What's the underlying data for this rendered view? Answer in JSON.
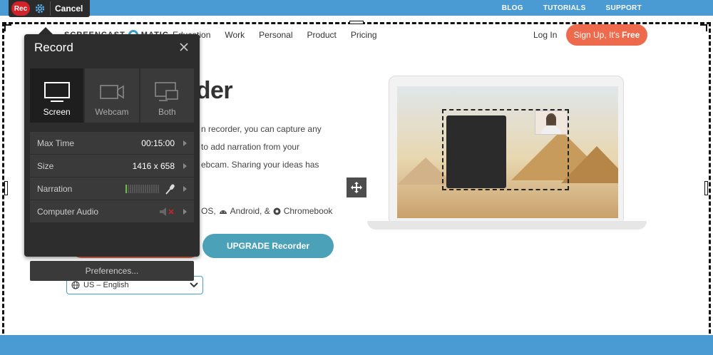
{
  "top_nav": {
    "blog": "BLOG",
    "tutorials": "TUTORIALS",
    "support": "SUPPORT"
  },
  "rec_toolbar": {
    "rec_label": "Rec",
    "cancel_label": "Cancel"
  },
  "site": {
    "logo_left": "SCREENCAST",
    "logo_right": "MATIC",
    "nav": [
      "Education",
      "Work",
      "Personal",
      "Product",
      "Pricing"
    ],
    "login": "Log In",
    "signup": "Sign Up, It's",
    "signup_bold": "Free",
    "hero_title_fragment": "rder",
    "hero_lines": [
      "n recorder, you can capture any",
      "to add narration from your",
      "ebcam. Sharing your ideas has"
    ],
    "platforms_prefix": "OS,",
    "platform_android": "Android, &",
    "platform_chromebook": "Chromebook",
    "upgrade_label": "UPGRADE Recorder",
    "language": "US – English"
  },
  "record_panel": {
    "title": "Record",
    "modes": [
      {
        "label": "Screen",
        "icon": "monitor-icon",
        "active": true
      },
      {
        "label": "Webcam",
        "icon": "webcam-icon",
        "active": false
      },
      {
        "label": "Both",
        "icon": "monitor-webcam-icon",
        "active": false
      }
    ],
    "max_time_label": "Max Time",
    "max_time_value": "00:15:00",
    "size_label": "Size",
    "size_value": "1416 x 658",
    "narration_label": "Narration",
    "computer_audio_label": "Computer Audio",
    "preferences_label": "Preferences..."
  },
  "colors": {
    "top_bar": "#4a9ad4",
    "rec_red": "#d2232a",
    "signup_orange": "#ee6a4c",
    "upgrade_teal": "#4aa1b8",
    "panel_dark": "#2d2d2d",
    "meter_green": "#6cc04a"
  }
}
